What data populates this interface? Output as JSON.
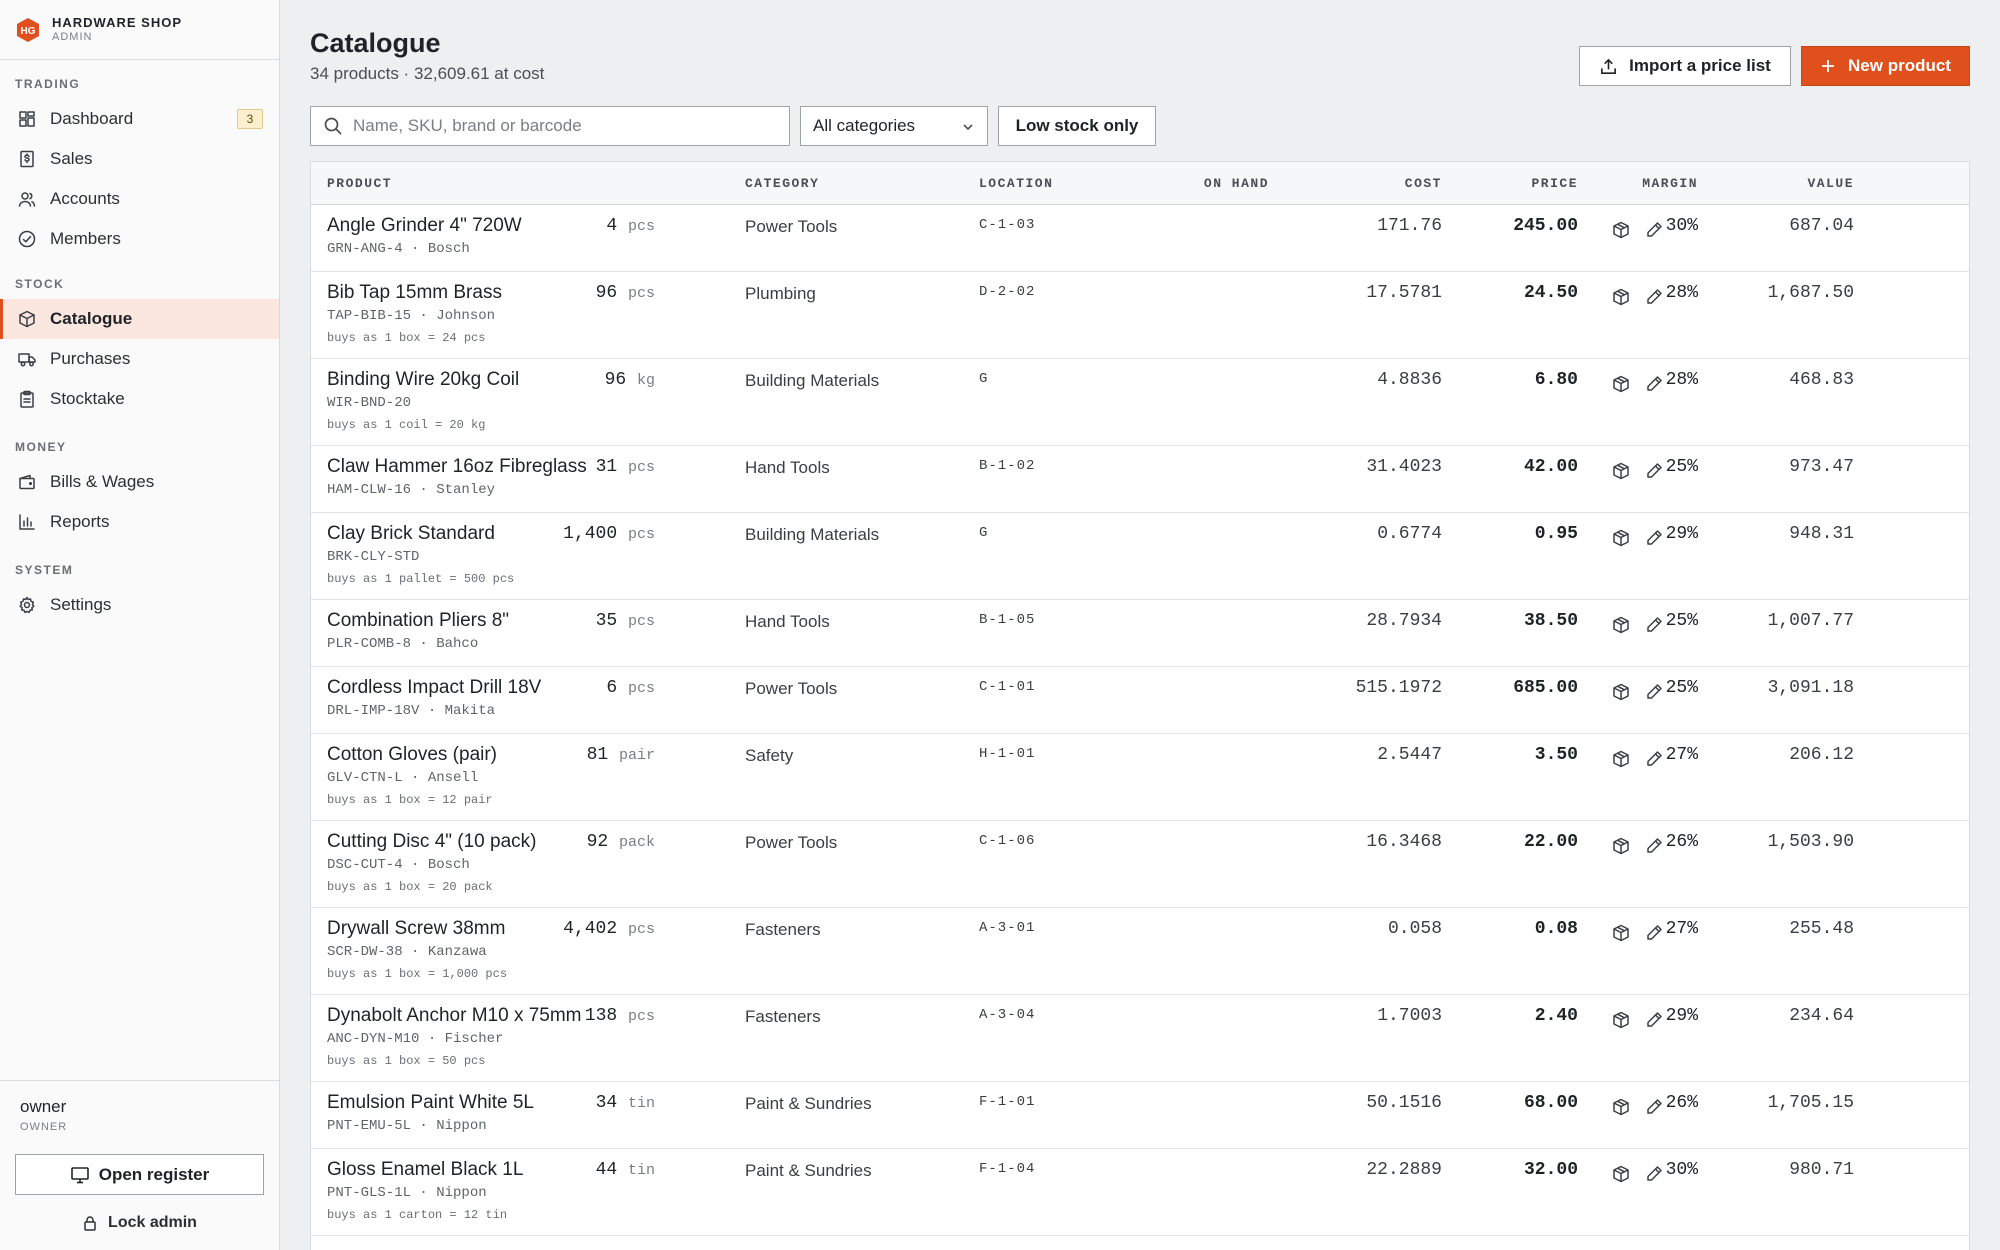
{
  "brand": {
    "name": "HARDWARE SHOP",
    "sub": "ADMIN",
    "logo_text": "HG"
  },
  "sidebar": {
    "sections": [
      {
        "label": "TRADING",
        "items": [
          {
            "label": "Dashboard",
            "icon": "dashboard-icon",
            "badge": "3"
          },
          {
            "label": "Sales",
            "icon": "receipt-icon"
          },
          {
            "label": "Accounts",
            "icon": "users-icon"
          },
          {
            "label": "Members",
            "icon": "badge-check-icon"
          }
        ]
      },
      {
        "label": "STOCK",
        "items": [
          {
            "label": "Catalogue",
            "icon": "package-icon",
            "active": true
          },
          {
            "label": "Purchases",
            "icon": "truck-icon"
          },
          {
            "label": "Stocktake",
            "icon": "clipboard-icon"
          }
        ]
      },
      {
        "label": "MONEY",
        "items": [
          {
            "label": "Bills & Wages",
            "icon": "wallet-icon"
          },
          {
            "label": "Reports",
            "icon": "bar-chart-icon"
          }
        ]
      },
      {
        "label": "SYSTEM",
        "items": [
          {
            "label": "Settings",
            "icon": "gear-icon"
          }
        ]
      }
    ],
    "user": {
      "name": "owner",
      "role": "OWNER"
    },
    "open_register": "Open register",
    "lock_admin": "Lock admin"
  },
  "page": {
    "title": "Catalogue",
    "subtitle": "34 products · 32,609.61 at cost",
    "import_label": "Import a price list",
    "new_label": "New product"
  },
  "filters": {
    "search_placeholder": "Name, SKU, brand or barcode",
    "category": "All categories",
    "low_stock": "Low stock only"
  },
  "table": {
    "columns": [
      "PRODUCT",
      "CATEGORY",
      "LOCATION",
      "ON HAND",
      "COST",
      "PRICE",
      "MARGIN",
      "VALUE"
    ],
    "rows": [
      {
        "name": "Angle Grinder 4\" 720W",
        "sku": "GRN-ANG-4 · Bosch",
        "buys": "",
        "category": "Power Tools",
        "location": "C-1-03",
        "on_hand": "4",
        "unit": "pcs",
        "cost": "171.76",
        "price": "245.00",
        "margin": "30%",
        "value": "687.04"
      },
      {
        "name": "Bib Tap 15mm Brass",
        "sku": "TAP-BIB-15 · Johnson",
        "buys": "buys as 1 box = 24 pcs",
        "category": "Plumbing",
        "location": "D-2-02",
        "on_hand": "96",
        "unit": "pcs",
        "cost": "17.5781",
        "price": "24.50",
        "margin": "28%",
        "value": "1,687.50"
      },
      {
        "name": "Binding Wire 20kg Coil",
        "sku": "WIR-BND-20",
        "buys": "buys as 1 coil = 20 kg",
        "category": "Building Materials",
        "location": "G",
        "on_hand": "96",
        "unit": "kg",
        "cost": "4.8836",
        "price": "6.80",
        "margin": "28%",
        "value": "468.83"
      },
      {
        "name": "Claw Hammer 16oz Fibreglass",
        "sku": "HAM-CLW-16 · Stanley",
        "buys": "",
        "category": "Hand Tools",
        "location": "B-1-02",
        "on_hand": "31",
        "unit": "pcs",
        "cost": "31.4023",
        "price": "42.00",
        "margin": "25%",
        "value": "973.47"
      },
      {
        "name": "Clay Brick Standard",
        "sku": "BRK-CLY-STD",
        "buys": "buys as 1 pallet = 500 pcs",
        "category": "Building Materials",
        "location": "G",
        "on_hand": "1,400",
        "unit": "pcs",
        "cost": "0.6774",
        "price": "0.95",
        "margin": "29%",
        "value": "948.31"
      },
      {
        "name": "Combination Pliers 8\"",
        "sku": "PLR-COMB-8 · Bahco",
        "buys": "",
        "category": "Hand Tools",
        "location": "B-1-05",
        "on_hand": "35",
        "unit": "pcs",
        "cost": "28.7934",
        "price": "38.50",
        "margin": "25%",
        "value": "1,007.77"
      },
      {
        "name": "Cordless Impact Drill 18V",
        "sku": "DRL-IMP-18V · Makita",
        "buys": "",
        "category": "Power Tools",
        "location": "C-1-01",
        "on_hand": "6",
        "unit": "pcs",
        "cost": "515.1972",
        "price": "685.00",
        "margin": "25%",
        "value": "3,091.18"
      },
      {
        "name": "Cotton Gloves (pair)",
        "sku": "GLV-CTN-L · Ansell",
        "buys": "buys as 1 box = 12 pair",
        "category": "Safety",
        "location": "H-1-01",
        "on_hand": "81",
        "unit": "pair",
        "cost": "2.5447",
        "price": "3.50",
        "margin": "27%",
        "value": "206.12"
      },
      {
        "name": "Cutting Disc 4\" (10 pack)",
        "sku": "DSC-CUT-4 · Bosch",
        "buys": "buys as 1 box = 20 pack",
        "category": "Power Tools",
        "location": "C-1-06",
        "on_hand": "92",
        "unit": "pack",
        "cost": "16.3468",
        "price": "22.00",
        "margin": "26%",
        "value": "1,503.90"
      },
      {
        "name": "Drywall Screw 38mm",
        "sku": "SCR-DW-38 · Kanzawa",
        "buys": "buys as 1 box = 1,000 pcs",
        "category": "Fasteners",
        "location": "A-3-01",
        "on_hand": "4,402",
        "unit": "pcs",
        "cost": "0.058",
        "price": "0.08",
        "margin": "27%",
        "value": "255.48"
      },
      {
        "name": "Dynabolt Anchor M10 x 75mm",
        "sku": "ANC-DYN-M10 · Fischer",
        "buys": "buys as 1 box = 50 pcs",
        "category": "Fasteners",
        "location": "A-3-04",
        "on_hand": "138",
        "unit": "pcs",
        "cost": "1.7003",
        "price": "2.40",
        "margin": "29%",
        "value": "234.64"
      },
      {
        "name": "Emulsion Paint White 5L",
        "sku": "PNT-EMU-5L · Nippon",
        "buys": "",
        "category": "Paint & Sundries",
        "location": "F-1-01",
        "on_hand": "34",
        "unit": "tin",
        "cost": "50.1516",
        "price": "68.00",
        "margin": "26%",
        "value": "1,705.15"
      },
      {
        "name": "Gloss Enamel Black 1L",
        "sku": "PNT-GLS-1L · Nippon",
        "buys": "buys as 1 carton = 12 tin",
        "category": "Paint & Sundries",
        "location": "F-1-04",
        "on_hand": "44",
        "unit": "tin",
        "cost": "22.2889",
        "price": "32.00",
        "margin": "30%",
        "value": "980.71"
      }
    ]
  },
  "colors": {
    "accent": "#e0501d",
    "active_bg": "#fbe7df",
    "badge_bg": "#fbefcf"
  }
}
